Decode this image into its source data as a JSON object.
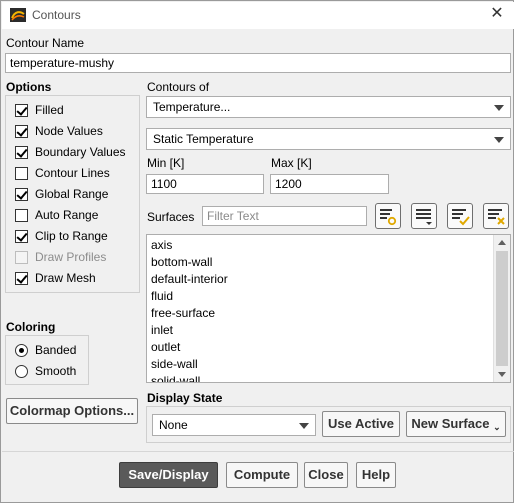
{
  "window": {
    "title": "Contours",
    "app_icon": "fluent-app-icon",
    "close_icon": "close-icon"
  },
  "contour_name": {
    "label": "Contour Name",
    "value": "temperature-mushy"
  },
  "options": {
    "label": "Options",
    "items": [
      {
        "label": "Filled",
        "checked": true,
        "disabled": false
      },
      {
        "label": "Node Values",
        "checked": true,
        "disabled": false
      },
      {
        "label": "Boundary Values",
        "checked": true,
        "disabled": false
      },
      {
        "label": "Contour Lines",
        "checked": false,
        "disabled": false
      },
      {
        "label": "Global Range",
        "checked": true,
        "disabled": false
      },
      {
        "label": "Auto Range",
        "checked": false,
        "disabled": false
      },
      {
        "label": "Clip to Range",
        "checked": true,
        "disabled": false
      },
      {
        "label": "Draw Profiles",
        "checked": false,
        "disabled": true
      },
      {
        "label": "Draw Mesh",
        "checked": true,
        "disabled": false
      }
    ]
  },
  "coloring": {
    "label": "Coloring",
    "items": [
      {
        "label": "Banded",
        "checked": true
      },
      {
        "label": "Smooth",
        "checked": false
      }
    ]
  },
  "colormap_button": "Colormap Options...",
  "contours_of": {
    "label": "Contours of",
    "category": "Temperature...",
    "variable": "Static Temperature"
  },
  "range": {
    "min_label": "Min [K]",
    "min_value": "1100",
    "max_label": "Max [K]",
    "max_value": "1200"
  },
  "surfaces": {
    "label": "Surfaces",
    "filter_placeholder": "Filter Text",
    "items": [
      "axis",
      "bottom-wall",
      "default-interior",
      "fluid",
      "free-surface",
      "inlet",
      "outlet",
      "side-wall",
      "solid-wall"
    ],
    "toolbar_icons": [
      "sort-surfaces-icon",
      "select-all-icon",
      "select-some-icon",
      "deselect-all-icon"
    ]
  },
  "display_state": {
    "label": "Display State",
    "value": "None",
    "use_active": "Use Active",
    "new_surface": "New Surface"
  },
  "footer": {
    "save_display": "Save/Display",
    "compute": "Compute",
    "close": "Close",
    "help": "Help"
  },
  "colors": {
    "primary_button": "#5a5a5a",
    "window_bg": "#f0f0f0",
    "accent_yellow": "#e0a800"
  }
}
